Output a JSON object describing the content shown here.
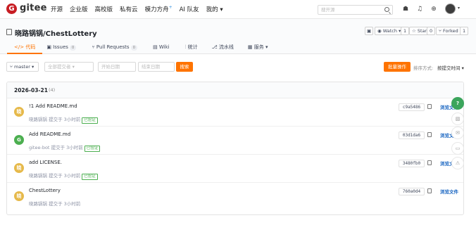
{
  "topnav": {
    "logo_glyph": "G",
    "brand": "gitee",
    "links": [
      "开源",
      "企业版",
      "高校版",
      "私有云",
      "模力方舟",
      "AI 队友",
      "我的 ▾"
    ],
    "ai_star": "+",
    "search_placeholder": "搜开源"
  },
  "repo": {
    "title": "晓路锅锅/ChestLottery",
    "watch_label": "◉ Watch ▾",
    "watch_count": "1",
    "star_label": "☆ Star",
    "star_count": "0",
    "fork_label": "⑂ Forked",
    "fork_count": "1",
    "tabs": [
      {
        "label": "</> 代码",
        "badge": ""
      },
      {
        "label": "▣ Issues",
        "badge": "0"
      },
      {
        "label": "⑂ Pull Requests",
        "badge": "0"
      },
      {
        "label": "▤ Wiki",
        "badge": ""
      },
      {
        "label": "⫶ 统计",
        "badge": ""
      },
      {
        "label": "⎇ 流水线",
        "badge": ""
      },
      {
        "label": "▦ 服务 ▾",
        "badge": ""
      }
    ]
  },
  "filters": {
    "branch": "⑂ master ▾",
    "committer_placeholder": "全部提交者 ▾",
    "start_placeholder": "开始日期",
    "end_placeholder": "结束日期",
    "search_button": "搜索",
    "batch_button": "批量操作",
    "sort_label": "排序方式:",
    "sort_value": "按提交时间 ▾"
  },
  "day": {
    "date": "2026-03-21",
    "count": "(4)"
  },
  "commits": [
    {
      "avatar": "晓",
      "avatar_color": "#e6b94a",
      "title": "!1 Add README.md",
      "author": "晓路锅锅",
      "time": "提交于 3小时前",
      "verified": "已验证",
      "sha": "c9a5486",
      "browse": "浏览文件"
    },
    {
      "avatar": "G",
      "avatar_color": "#4caf50",
      "title": "Add README.md",
      "author": "gitee-bot",
      "time": "提交于 3小时前",
      "verified": "已验证",
      "sha": "03d1da6",
      "browse": "浏览文件"
    },
    {
      "avatar": "晓",
      "avatar_color": "#e6b94a",
      "title": "add LICENSE.",
      "author": "晓路锅锅",
      "time": "提交于 3小时前",
      "verified": "已验证",
      "sha": "3480fb0",
      "browse": "浏览文件"
    },
    {
      "avatar": "晓",
      "avatar_color": "#e6b94a",
      "title": "ChestLottery",
      "author": "晓路锅锅",
      "time": "提交于 3小时前",
      "verified": "",
      "sha": "760a0d4",
      "browse": "浏览文件"
    }
  ],
  "sidebar_tools": {
    "help": "?"
  },
  "colors": {
    "accent": "#fe7300",
    "link": "#1a66c2",
    "verified": "#4caf50"
  }
}
